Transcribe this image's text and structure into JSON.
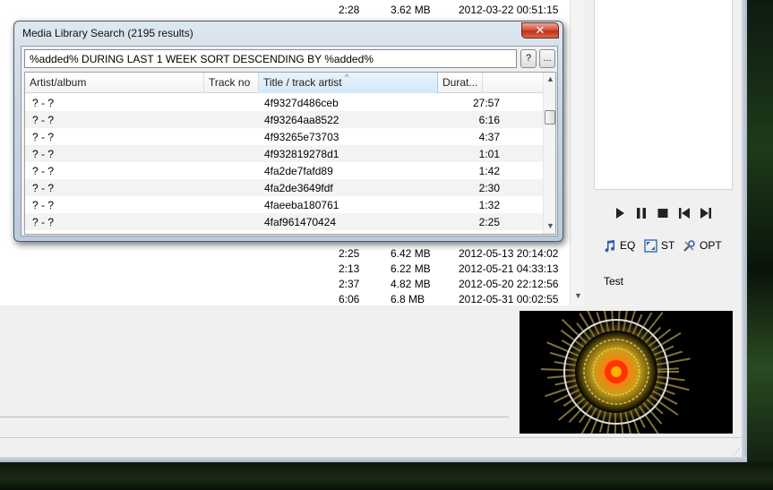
{
  "playlist": {
    "top_rows": [
      {
        "duration": "2:28",
        "size": "3.62 MB",
        "date": "2012-03-22 00:51:15"
      }
    ],
    "bottom_rows": [
      {
        "duration": "2:25",
        "size": "6.42 MB",
        "date": "2012-05-13 20:14:02"
      },
      {
        "duration": "2:13",
        "size": "6.22 MB",
        "date": "2012-05-21 04:33:13"
      },
      {
        "duration": "2:37",
        "size": "4.82 MB",
        "date": "2012-05-20 22:12:56"
      },
      {
        "duration": "6:06",
        "size": "6.8 MB",
        "date": "2012-05-31 00:02:55"
      }
    ]
  },
  "controls": {
    "transport_icons": [
      "play-icon",
      "pause-icon",
      "stop-icon",
      "previous-icon",
      "next-icon"
    ],
    "tools": [
      {
        "label": "EQ",
        "icon": "music-note-icon"
      },
      {
        "label": "ST",
        "icon": "expand-icon"
      },
      {
        "label": "OPT",
        "icon": "tools-icon"
      }
    ],
    "test_label": "Test"
  },
  "dialog": {
    "title": "Media Library Search (2195 results)",
    "close_label": "✕",
    "query": "%added% DURING LAST 1 WEEK SORT DESCENDING BY %added%",
    "help_label": "?",
    "more_label": "...",
    "columns": [
      "Artist/album",
      "Track no",
      "Title / track artist",
      "Durat..."
    ],
    "sorted_column_caret": "^",
    "rows": [
      {
        "artist": "? - ?",
        "track": "",
        "title": "4f9327d486ceb",
        "duration": "27:57"
      },
      {
        "artist": "? - ?",
        "track": "",
        "title": "4f93264aa8522",
        "duration": "6:16"
      },
      {
        "artist": "? - ?",
        "track": "",
        "title": "4f93265e73703",
        "duration": "4:37"
      },
      {
        "artist": "? - ?",
        "track": "",
        "title": "4f932819278d1",
        "duration": "1:01"
      },
      {
        "artist": "? - ?",
        "track": "",
        "title": "4fa2de7fafd89",
        "duration": "1:42"
      },
      {
        "artist": "? - ?",
        "track": "",
        "title": "4fa2de3649fdf",
        "duration": "2:30"
      },
      {
        "artist": "? - ?",
        "track": "",
        "title": "4faeeba180761",
        "duration": "1:32"
      },
      {
        "artist": "? - ?",
        "track": "",
        "title": "4faf961470424",
        "duration": "2:25"
      }
    ]
  },
  "colors": {
    "dialog_frame": "#bccbdc",
    "close_button": "#c2301a",
    "sorted_header": "#d3e8f8",
    "visualizer_bg": "#000000"
  }
}
